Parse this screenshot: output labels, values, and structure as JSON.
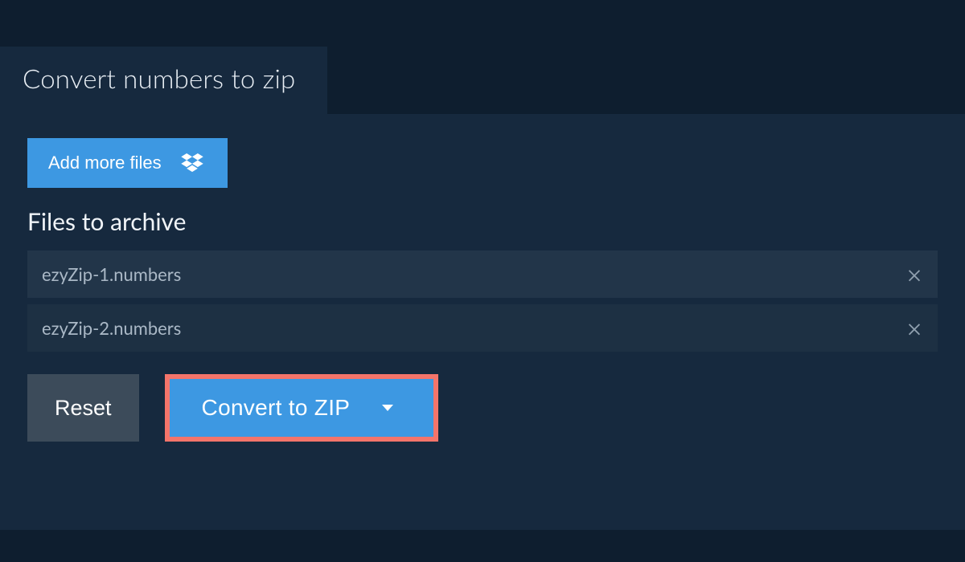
{
  "tab": {
    "label": "Convert numbers to zip"
  },
  "add_button": {
    "label": "Add more files"
  },
  "section": {
    "title": "Files to archive"
  },
  "files": [
    {
      "name": "ezyZip-1.numbers"
    },
    {
      "name": "ezyZip-2.numbers"
    }
  ],
  "actions": {
    "reset": "Reset",
    "convert": "Convert to ZIP"
  }
}
